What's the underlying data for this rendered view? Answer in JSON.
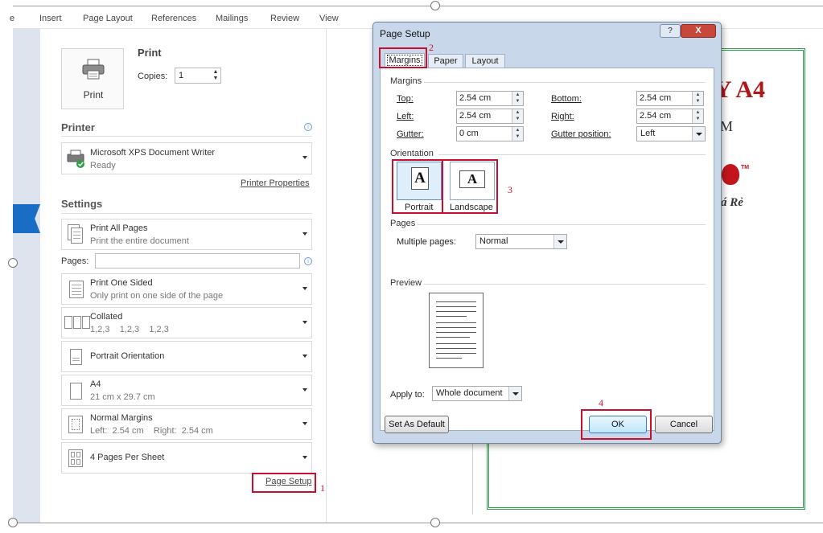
{
  "ribbon": {
    "tabs": [
      "Insert",
      "Page Layout",
      "References",
      "Mailings",
      "Review",
      "View"
    ],
    "first_tab_fragment": "e"
  },
  "backstage": {
    "print_section_title": "Print",
    "print_button_label": "Print",
    "copies_label": "Copies:",
    "copies_value": "1",
    "printer_title": "Printer",
    "printer": {
      "name": "Microsoft XPS Document Writer",
      "status": "Ready"
    },
    "printer_properties_link": "Printer Properties",
    "settings_title": "Settings",
    "pages_label": "Pages:",
    "pages_value": "",
    "settings": [
      {
        "main": "Print All Pages",
        "sub": "Print the entire document",
        "icon": "pages-icon"
      },
      {
        "main": "Print One Sided",
        "sub": "Only print on one side of the page",
        "icon": "one-sided-icon"
      },
      {
        "main": "Collated",
        "sub": "1,2,3    1,2,3    1,2,3",
        "icon": "collated-icon"
      },
      {
        "main": "Portrait Orientation",
        "sub": "",
        "icon": "portrait-icon"
      },
      {
        "main": "A4",
        "sub": "21 cm x 29.7 cm",
        "icon": "paper-size-icon"
      },
      {
        "main": "Normal Margins",
        "sub": "Left:  2.54 cm    Right:  2.54 cm",
        "icon": "margins-icon"
      },
      {
        "main": "4 Pages Per Sheet",
        "sub": "",
        "icon": "pages-per-sheet-icon"
      }
    ],
    "page_setup_link": "Page Setup"
  },
  "dialog": {
    "title": "Page Setup",
    "help_glyph": "?",
    "close_glyph": "X",
    "tabs": [
      "Margins",
      "Paper",
      "Layout"
    ],
    "margins_group": "Margins",
    "fields": {
      "top_label": "Top:",
      "top_value": "2.54 cm",
      "bottom_label": "Bottom:",
      "bottom_value": "2.54 cm",
      "left_label": "Left:",
      "left_value": "2.54 cm",
      "right_label": "Right:",
      "right_value": "2.54 cm",
      "gutter_label": "Gutter:",
      "gutter_value": "0 cm",
      "gutter_position_label": "Gutter position:",
      "gutter_position_value": "Left"
    },
    "orientation_group": "Orientation",
    "orientation": {
      "portrait_label": "Portrait",
      "landscape_label": "Landscape",
      "glyph": "A"
    },
    "pages_group": "Pages",
    "multiple_pages_label": "Multiple pages:",
    "multiple_pages_value": "Normal",
    "preview_group": "Preview",
    "apply_to_label": "Apply to:",
    "apply_to_value": "Whole document",
    "set_default_button": "Set As Default",
    "ok_button": "OK",
    "cancel_button": "Cancel"
  },
  "document": {
    "heading_fragment": "Y A4",
    "line2_fragment": "M",
    "tm_mark": "TM",
    "line3_fragment": "á Rẻ"
  },
  "annotations": [
    "1",
    "2",
    "3",
    "4"
  ],
  "colors": {
    "annotation_red": "#c8102e",
    "document_green": "#2a9d48",
    "heading_red": "#b01818",
    "dialog_frame": "#c8d8ea",
    "close_red": "#c9473a",
    "accent_blue": "#1a6dc4"
  }
}
